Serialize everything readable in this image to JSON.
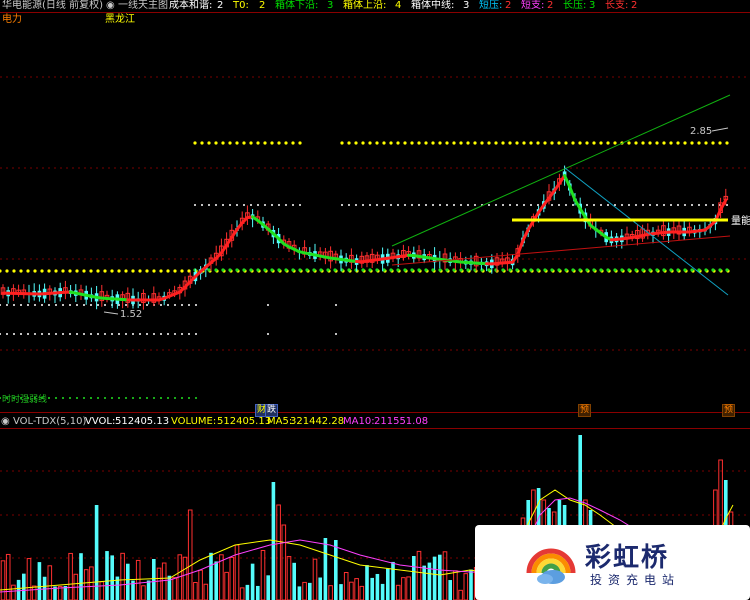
{
  "header": {
    "stock_title": "华电能源(日线 前复权)",
    "indicator_name": "一线天主图",
    "params": [
      {
        "label": "成本和谐:",
        "value": "2",
        "label_color": "#ffffff",
        "value_color": "#ffffff"
      },
      {
        "label": "T0:",
        "value": "2",
        "label_color": "#ffff00",
        "value_color": "#ffff00"
      },
      {
        "label": "箱体下沿:",
        "value": "3",
        "label_color": "#00e000",
        "value_color": "#00e000"
      },
      {
        "label": "箱体上沿:",
        "value": "4",
        "label_color": "#ffff00",
        "value_color": "#ffff00"
      },
      {
        "label": "箱体中线:",
        "value": "3",
        "label_color": "#ffffff",
        "value_color": "#ffffff"
      },
      {
        "label": "短压:",
        "value": "2",
        "label_color": "#00c8ff",
        "value_color": "#ff3030"
      },
      {
        "label": "短支:",
        "value": "2",
        "label_color": "#ff40ff",
        "value_color": "#ff3030"
      },
      {
        "label": "长压:",
        "value": "3",
        "label_color": "#00e000",
        "value_color": "#00e000"
      },
      {
        "label": "长支:",
        "value": "2",
        "label_color": "#ff3030",
        "value_color": "#ff3030"
      }
    ],
    "sector": "电力",
    "region": "黑龙江"
  },
  "main_chart": {
    "price_high_label": "2.85",
    "price_low_label": "1.52",
    "right_label": "量能",
    "bottom_left_label": "时时强弱线",
    "markers": [
      {
        "text": "财",
        "color": "#ffff00"
      },
      {
        "text": "跌",
        "color": "#00e000"
      },
      {
        "text": "预",
        "color": "#ff8000"
      },
      {
        "text": "预",
        "color": "#ff8000"
      }
    ]
  },
  "volume": {
    "name": "VOL-TDX(5,10)",
    "vvol_label": "VVOL:",
    "vvol_value": "512405.13",
    "volume_label": "VOLUME:",
    "volume_value": "512405.13",
    "ma5_label": "MA5:",
    "ma5_value": "321442.28",
    "ma10_label": "MA10:",
    "ma10_value": "211551.08"
  },
  "watermark": {
    "brand": "彩虹桥",
    "subtitle": "投资充电站"
  },
  "colors": {
    "up": "#ff3030",
    "down": "#54fcfc",
    "ma_red": "#ff2020",
    "ma_green": "#20e020",
    "yellow": "#ffff00",
    "grid": "#a00000"
  }
}
